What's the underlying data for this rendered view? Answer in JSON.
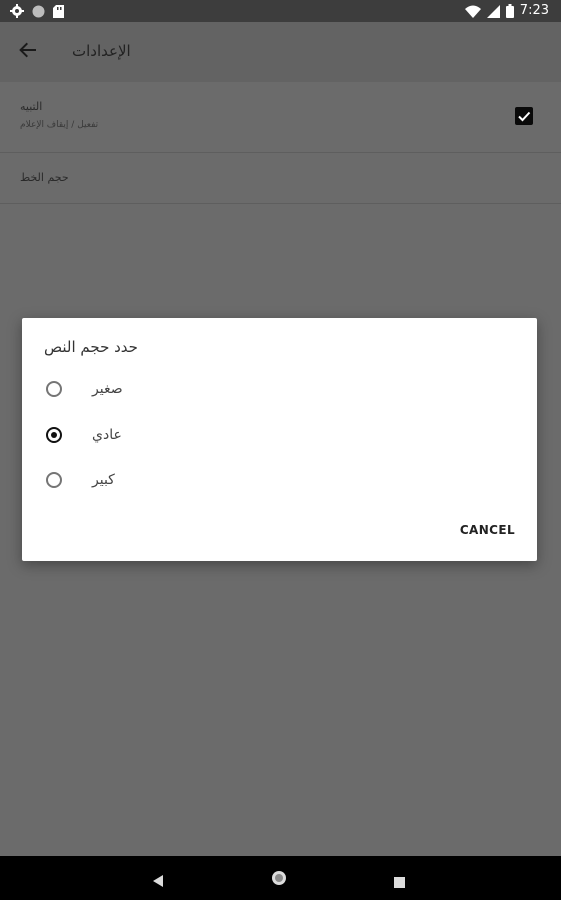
{
  "status_bar": {
    "time": "7:23",
    "left_icons": [
      "gear-icon",
      "circle-icon",
      "sd-card-icon"
    ],
    "right_icons": [
      "wifi-icon",
      "signal-icon",
      "battery-icon"
    ]
  },
  "app_bar": {
    "title": "الإعدادات",
    "back_icon": "arrow-back-icon"
  },
  "settings": {
    "items": [
      {
        "title": "التبيه",
        "subtitle": "تفعيل / إيقاف الإعلام",
        "checked": true
      },
      {
        "title": "حجم الخط",
        "subtitle": ""
      }
    ]
  },
  "dialog": {
    "title": "حدد حجم النص",
    "options": [
      {
        "label": "صغير",
        "selected": false
      },
      {
        "label": "عادي",
        "selected": true
      },
      {
        "label": "كبير",
        "selected": false
      }
    ],
    "cancel_label": "CANCEL"
  },
  "nav_bar": {
    "buttons": [
      "back-triangle-icon",
      "home-circle-icon",
      "recents-square-icon"
    ]
  }
}
